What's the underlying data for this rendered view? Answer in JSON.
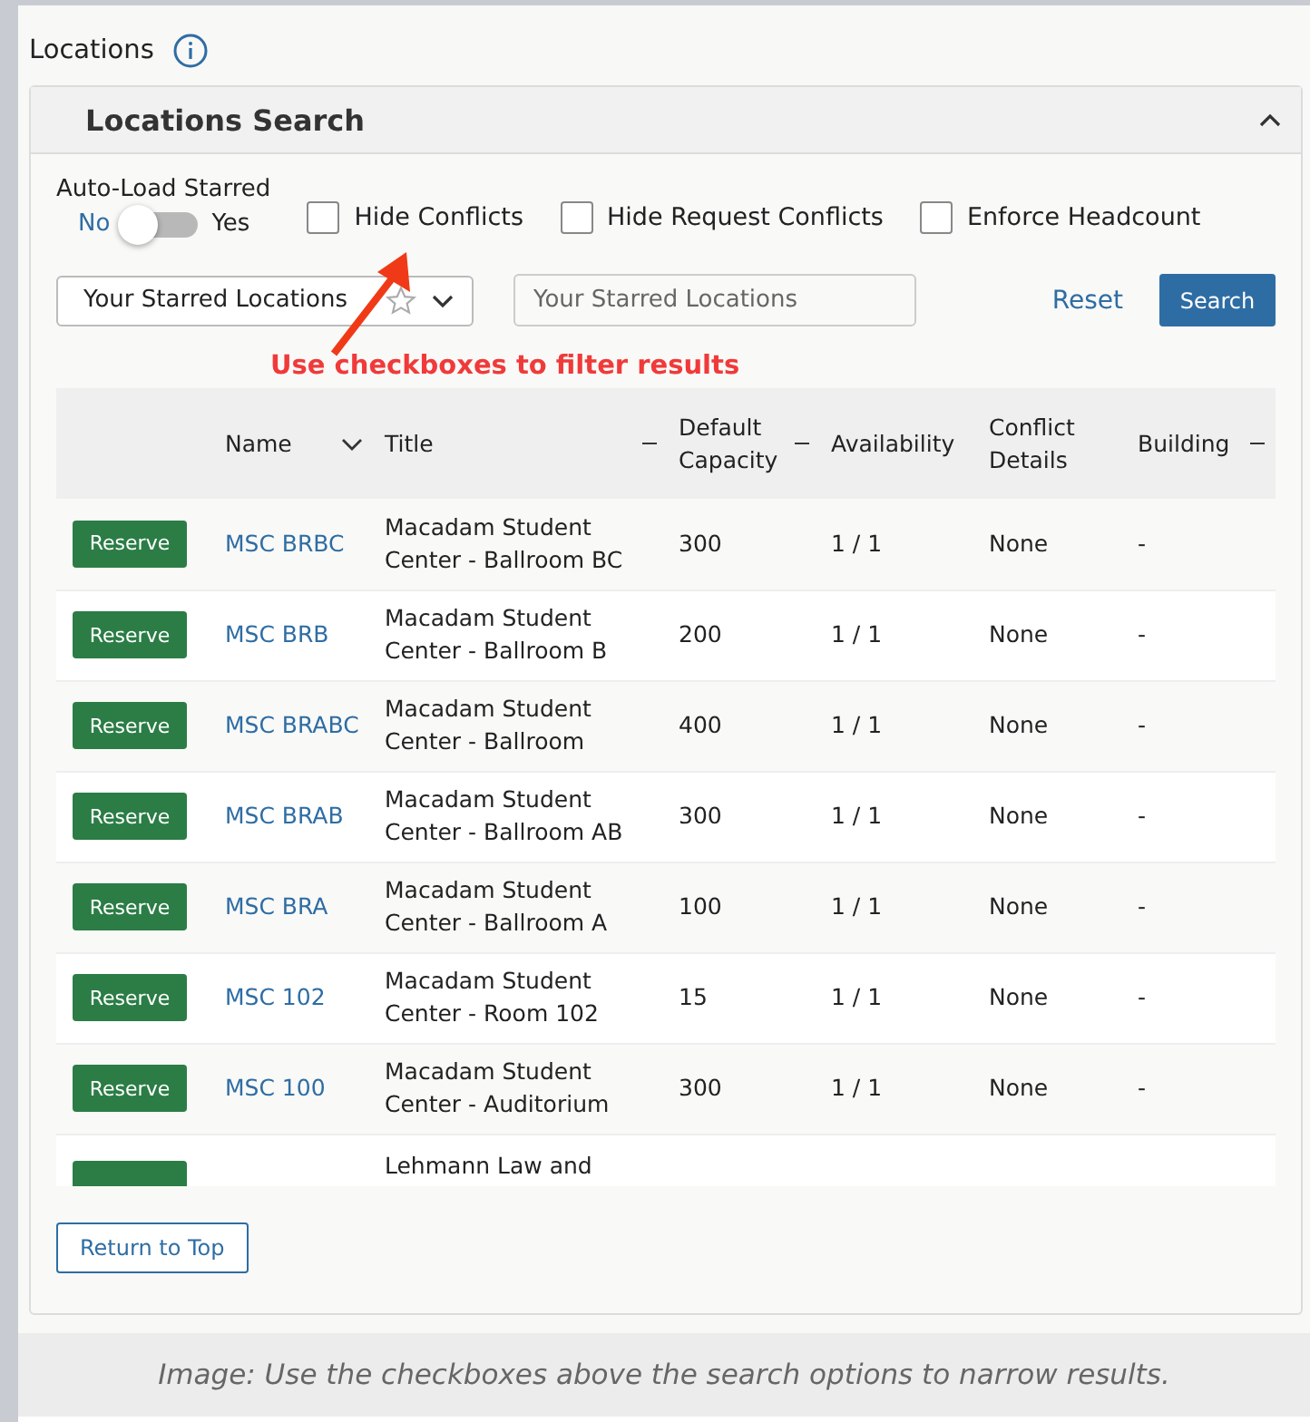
{
  "page_title": "Locations",
  "panel": {
    "title": "Locations Search",
    "expanded": true
  },
  "auto_load": {
    "label": "Auto-Load Starred",
    "off_label": "No",
    "on_label": "Yes",
    "on": false
  },
  "filters": [
    {
      "label": "Hide Conflicts",
      "checked": false
    },
    {
      "label": "Hide Request Conflicts",
      "checked": false
    },
    {
      "label": "Enforce Headcount",
      "checked": false
    }
  ],
  "search_type": {
    "value": "Your Starred Locations",
    "starred": false
  },
  "search_field": {
    "placeholder": "Your Starred Locations"
  },
  "reset": "Reset",
  "search": "Search",
  "annotation": "Use checkboxes to filter results",
  "table": {
    "columns": [
      "Name",
      "Title",
      "Default Capacity",
      "Availability",
      "Conflict Details",
      "Building"
    ],
    "rows": [
      {
        "action": "Reserve",
        "name": "MSC BRBC",
        "title": "Macadam Student Center - Ballroom BC",
        "capacity": "300",
        "availability": "1 / 1",
        "conflict": "None",
        "building": "-"
      },
      {
        "action": "Reserve",
        "name": "MSC BRB",
        "title": "Macadam Student Center - Ballroom B",
        "capacity": "200",
        "availability": "1 / 1",
        "conflict": "None",
        "building": "-"
      },
      {
        "action": "Reserve",
        "name": "MSC BRABC",
        "title": "Macadam Student Center - Ballroom",
        "capacity": "400",
        "availability": "1 / 1",
        "conflict": "None",
        "building": "-"
      },
      {
        "action": "Reserve",
        "name": "MSC BRAB",
        "title": "Macadam Student Center - Ballroom AB",
        "capacity": "300",
        "availability": "1 / 1",
        "conflict": "None",
        "building": "-"
      },
      {
        "action": "Reserve",
        "name": "MSC BRA",
        "title": "Macadam Student Center - Ballroom A",
        "capacity": "100",
        "availability": "1 / 1",
        "conflict": "None",
        "building": "-"
      },
      {
        "action": "Reserve",
        "name": "MSC 102",
        "title": "Macadam Student Center - Room 102",
        "capacity": "15",
        "availability": "1 / 1",
        "conflict": "None",
        "building": "-"
      },
      {
        "action": "Reserve",
        "name": "MSC 100",
        "title": "Macadam Student Center - Auditorium",
        "capacity": "300",
        "availability": "1 / 1",
        "conflict": "None",
        "building": "-"
      },
      {
        "title": "Lehmann Law and"
      }
    ]
  },
  "return_top": "Return to Top",
  "caption": "Image: Use the checkboxes above the search options to narrow results."
}
